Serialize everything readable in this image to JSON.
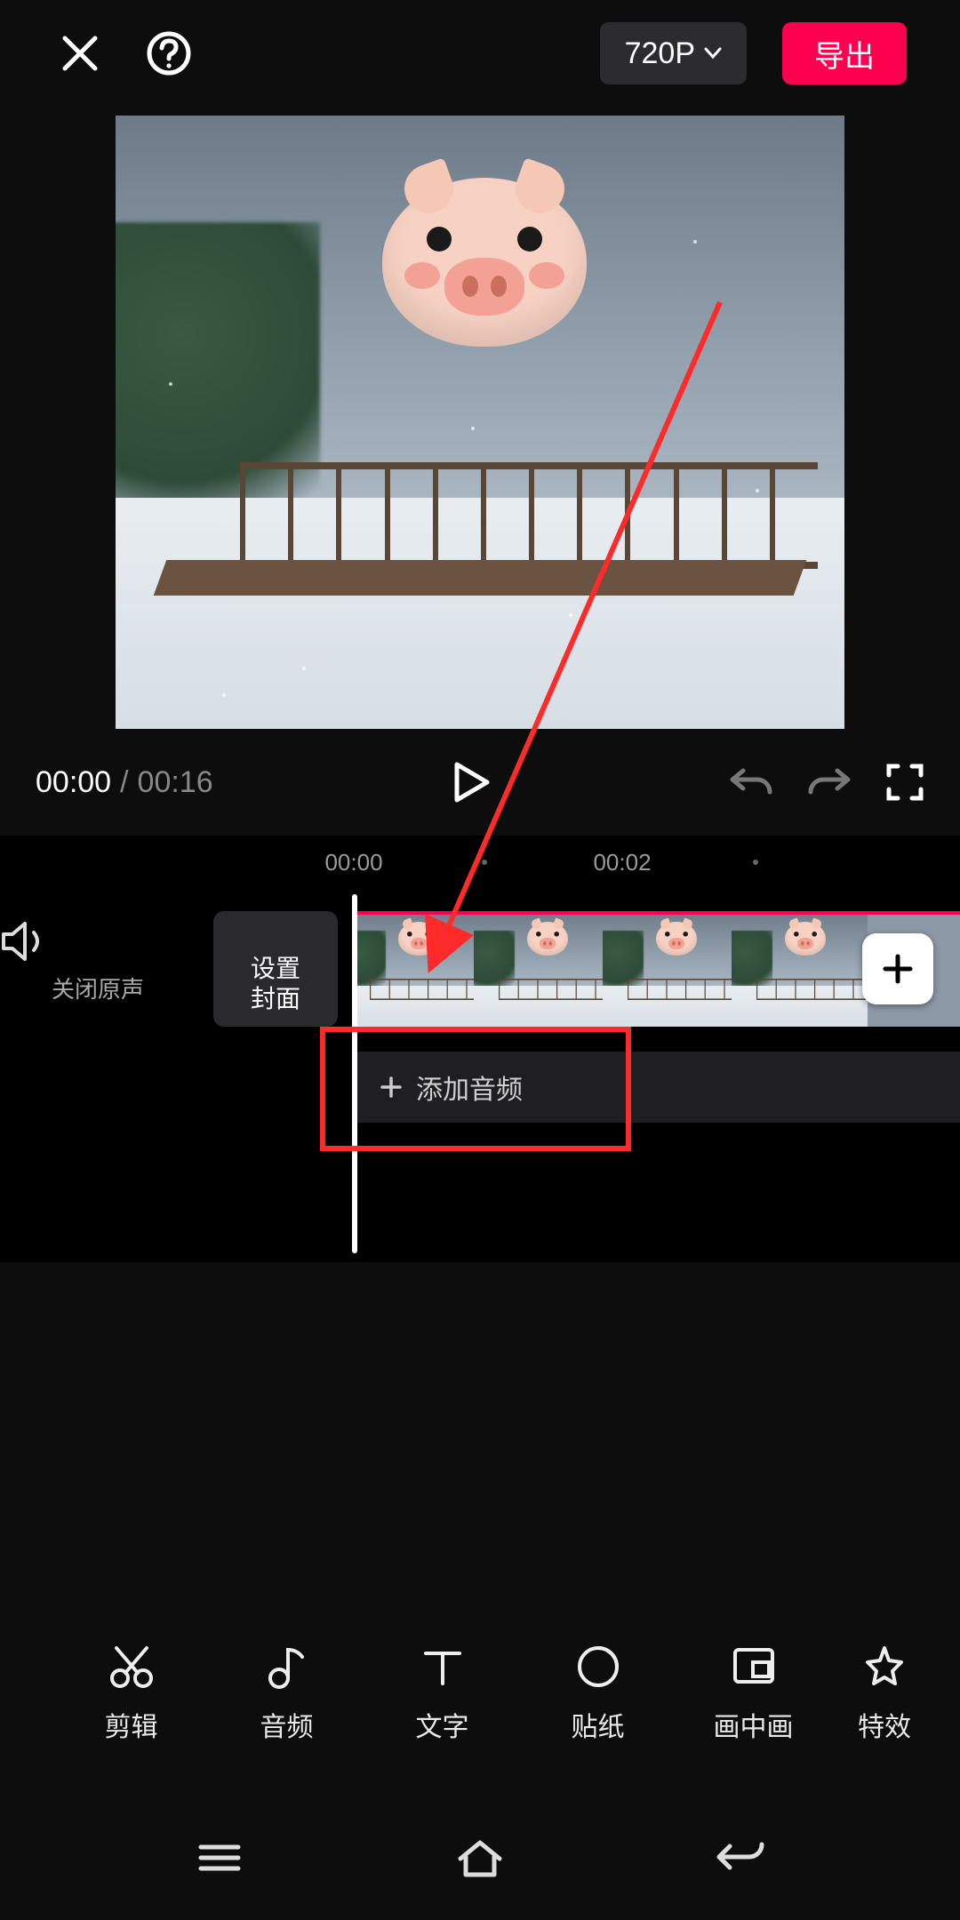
{
  "topbar": {
    "quality_label": "720P",
    "export_label": "导出"
  },
  "playback": {
    "current_time": "00:00",
    "separator": " / ",
    "duration": "00:16"
  },
  "timeline": {
    "ruler": [
      "00:00",
      "00:02"
    ],
    "mute_label": "关闭原声",
    "cover_label": "设置\n封面",
    "add_audio_label": "添加音频"
  },
  "toolbar": {
    "items": [
      {
        "icon": "scissors-icon",
        "label": "剪辑"
      },
      {
        "icon": "music-note-icon",
        "label": "音频"
      },
      {
        "icon": "text-icon",
        "label": "文字"
      },
      {
        "icon": "sticker-icon",
        "label": "贴纸"
      },
      {
        "icon": "pip-icon",
        "label": "画中画"
      },
      {
        "icon": "effects-icon",
        "label": "特效"
      }
    ]
  },
  "annotation": {
    "highlight_target": "add-audio-button",
    "arrow_from": "preview-top-right",
    "arrow_to": "add-audio-button",
    "color": "#ff2b2b"
  }
}
